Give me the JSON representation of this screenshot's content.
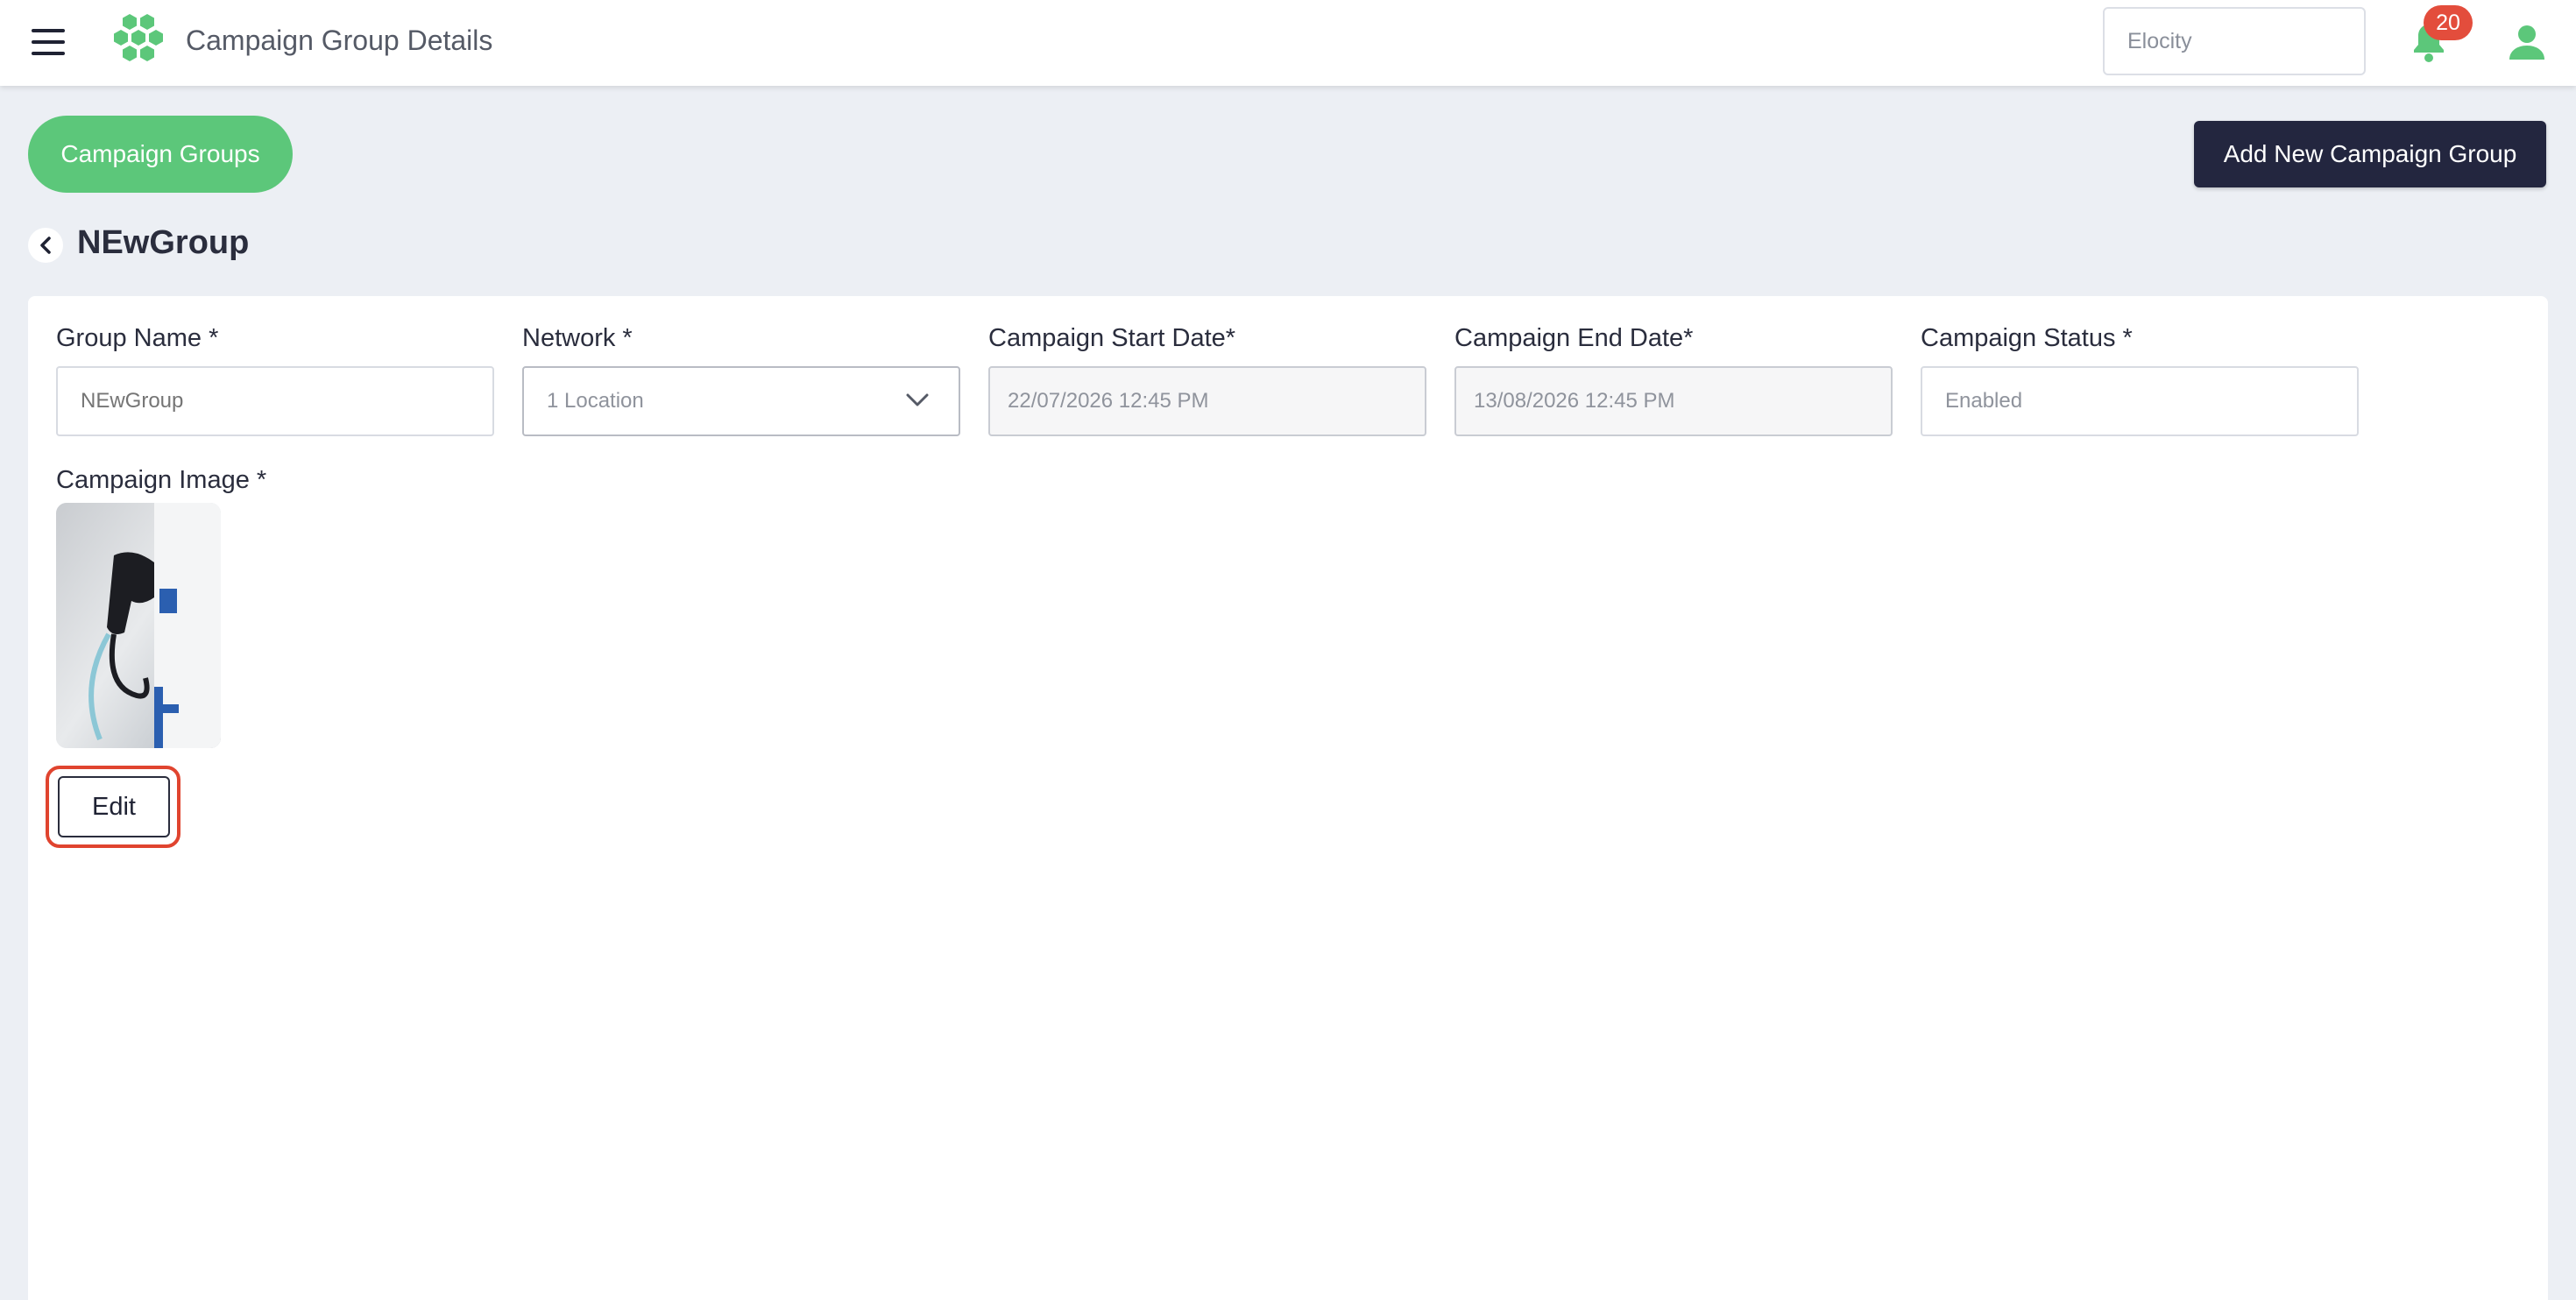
{
  "header": {
    "title": "Campaign Group Details",
    "org_placeholder": "Elocity",
    "notification_count": "20",
    "brand_color": "#5cc77a"
  },
  "actions": {
    "campaign_groups_label": "Campaign Groups",
    "add_new_label": "Add New Campaign Group"
  },
  "group": {
    "title": "NEwGroup"
  },
  "form": {
    "group_name": {
      "label": "Group Name *",
      "placeholder": "NEwGroup"
    },
    "network": {
      "label": "Network *",
      "value": "1 Location"
    },
    "start_date": {
      "label": "Campaign Start Date*",
      "value": "22/07/2026 12:45 PM"
    },
    "end_date": {
      "label": "Campaign End Date*",
      "value": "13/08/2026 12:45 PM"
    },
    "status": {
      "label": "Campaign Status *",
      "value": "Enabled"
    },
    "image": {
      "label": "Campaign Image *"
    },
    "edit_label": "Edit"
  }
}
